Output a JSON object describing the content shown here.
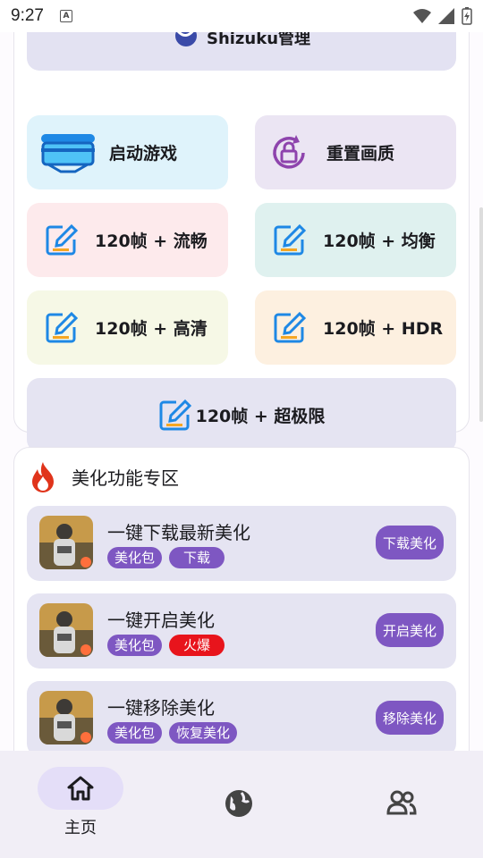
{
  "status_bar": {
    "time": "9:27"
  },
  "top_card": {
    "shizuku_label": "Shizuku管理",
    "tiles": [
      {
        "label": "启动游戏",
        "color": "#dff3fb"
      },
      {
        "label": "重置画质",
        "color": "#ebe5f3"
      },
      {
        "label": "120帧 + 流畅",
        "color": "#fdeaec"
      },
      {
        "label": "120帧 + 均衡",
        "color": "#dff1ef"
      },
      {
        "label": "120帧 + 高清",
        "color": "#f6f8e6"
      },
      {
        "label": "120帧 + HDR",
        "color": "#fdf0e0"
      },
      {
        "label": "120帧 + 超极限",
        "color": "#e5e4f2"
      }
    ]
  },
  "beautify_section": {
    "title": "美化功能专区",
    "items": [
      {
        "name": "一键下载最新美化",
        "tags": [
          "美化包",
          "下载"
        ],
        "action": "下载美化"
      },
      {
        "name": "一键开启美化",
        "tags": [
          "美化包",
          "火爆"
        ],
        "action": "开启美化"
      },
      {
        "name": "一键移除美化",
        "tags": [
          "美化包",
          "恢复美化"
        ],
        "action": "移除美化"
      }
    ]
  },
  "bottom_nav": {
    "home_label": "主页",
    "icons": [
      "home-icon",
      "globe-icon",
      "people-icon"
    ]
  },
  "colors": {
    "accent": "#7e57c2",
    "hot": "#e8141c"
  }
}
